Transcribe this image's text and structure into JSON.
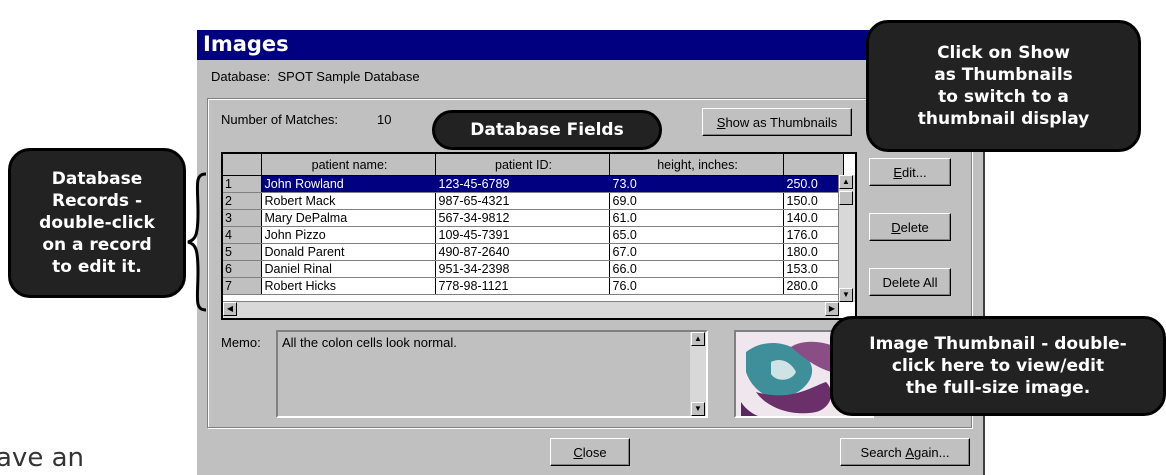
{
  "window": {
    "title": "Images"
  },
  "database": {
    "label": "Database:",
    "name": "SPOT Sample Database"
  },
  "matches": {
    "label": "Number of Matches:",
    "count": "10"
  },
  "buttons": {
    "thumbnails": {
      "pre": "",
      "u": "S",
      "post": "how as Thumbnails"
    },
    "edit": {
      "pre": "",
      "u": "E",
      "post": "dit..."
    },
    "delete": {
      "pre": "",
      "u": "D",
      "post": "elete"
    },
    "delete_all": "Delete All",
    "close": {
      "pre": "",
      "u": "C",
      "post": "lose"
    },
    "search_again": {
      "pre": "Search ",
      "u": "A",
      "post": "gain..."
    }
  },
  "grid": {
    "columns": [
      "patient name:",
      "patient ID:",
      "height, inches:",
      ""
    ],
    "rows": [
      {
        "num": "1",
        "name": "John Rowland",
        "id": "123-45-6789",
        "height": "73.0",
        "extra": "250.0"
      },
      {
        "num": "2",
        "name": "Robert Mack",
        "id": "987-65-4321",
        "height": "69.0",
        "extra": "150.0"
      },
      {
        "num": "3",
        "name": "Mary DePalma",
        "id": "567-34-9812",
        "height": "61.0",
        "extra": "140.0"
      },
      {
        "num": "4",
        "name": "John Pizzo",
        "id": "109-45-7391",
        "height": "65.0",
        "extra": "176.0"
      },
      {
        "num": "5",
        "name": "Donald Parent",
        "id": "490-87-2640",
        "height": "67.0",
        "extra": "180.0"
      },
      {
        "num": "6",
        "name": "Daniel Rinal",
        "id": "951-34-2398",
        "height": "66.0",
        "extra": "153.0"
      },
      {
        "num": "7",
        "name": "Robert Hicks",
        "id": "778-98-1121",
        "height": "76.0",
        "extra": "280.0"
      }
    ],
    "selected_row": "1"
  },
  "memo": {
    "label": "Memo:",
    "text": "All the colon cells look normal."
  },
  "callouts": {
    "thumbnails": [
      "Click on Show",
      "as Thumbnails",
      "to switch to a",
      "thumbnail display"
    ],
    "fields": "Database Fields",
    "records": [
      "Database",
      "Records -",
      "double-click",
      "on a record",
      "to edit it."
    ],
    "image": [
      "Image Thumbnail - double-",
      "click here to view/edit",
      "the full-size image."
    ]
  },
  "background_text": "ave an",
  "colors": {
    "titlebar": "#000080",
    "selection": "#000080",
    "window": "#c0c0c0",
    "callout": "#222222"
  }
}
